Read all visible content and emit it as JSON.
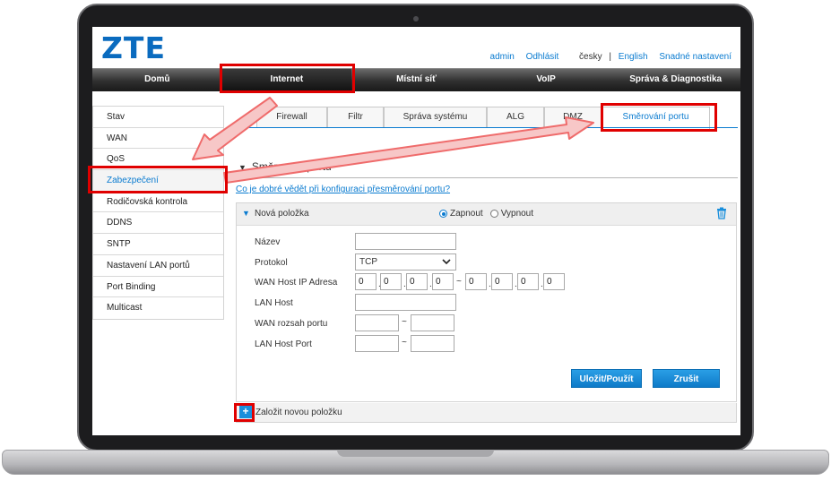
{
  "header": {
    "logo": "ZTE",
    "admin": "admin",
    "logout": "Odhlásit",
    "lang_current": "česky",
    "separator": "|",
    "lang_other": "English",
    "easy_setup": "Snadné nastavení"
  },
  "main_nav": [
    {
      "label": "Domů"
    },
    {
      "label": "Internet"
    },
    {
      "label": "Místní síť"
    },
    {
      "label": "VoIP"
    },
    {
      "label": "Správa & Diagnostika"
    }
  ],
  "sidebar": [
    {
      "label": "Stav"
    },
    {
      "label": "WAN"
    },
    {
      "label": "QoS"
    },
    {
      "label": "Zabezpečení"
    },
    {
      "label": "Rodičovská kontrola"
    },
    {
      "label": "DDNS"
    },
    {
      "label": "SNTP"
    },
    {
      "label": "Nastavení LAN portů"
    },
    {
      "label": "Port Binding"
    },
    {
      "label": "Multicast"
    }
  ],
  "sub_tabs": [
    {
      "label": "Firewall"
    },
    {
      "label": "Filtr"
    },
    {
      "label": "Správa systému"
    },
    {
      "label": "ALG"
    },
    {
      "label": "DMZ"
    },
    {
      "label": "Směrování portu"
    }
  ],
  "section": {
    "title": "Směrování portu",
    "help_link": "Co je dobré vědět při konfiguraci přesměrování portu?"
  },
  "form": {
    "title": "Nová položka",
    "radio_on": "Zapnout",
    "radio_off": "Vypnout",
    "labels": {
      "name": "Název",
      "protocol": "Protokol",
      "wan_ip": "WAN Host IP Adresa",
      "lan_host": "LAN Host",
      "wan_port": "WAN rozsah portu",
      "lan_port": "LAN Host Port"
    },
    "protocol_value": "TCP",
    "ip_start": [
      "0",
      "0",
      "0",
      "0"
    ],
    "ip_end": [
      "0",
      "0",
      "0",
      "0"
    ],
    "dot": ".",
    "range_sep": "~",
    "save": "Uložit/Použít",
    "cancel": "Zrušit"
  },
  "add_row": {
    "icon": "+",
    "label": "Založit novou položku"
  },
  "colors": {
    "accent": "#0a7bd0",
    "highlight": "#e00000",
    "arrow_fill": "#f7c7c7",
    "arrow_stroke": "#ef6b6b"
  }
}
